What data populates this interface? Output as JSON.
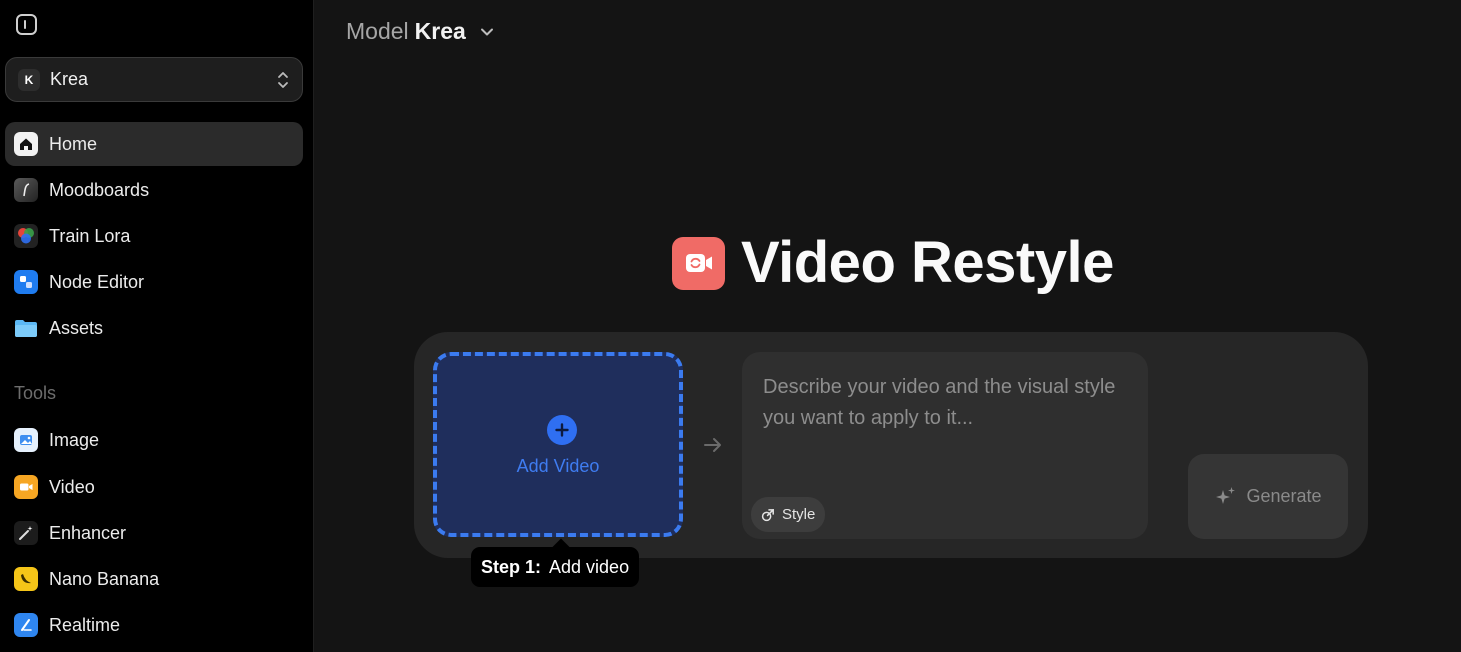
{
  "sidebar": {
    "workspace": {
      "logo": "K",
      "name": "Krea"
    },
    "nav": [
      {
        "label": "Home",
        "icon": "home-icon",
        "active": true
      },
      {
        "label": "Moodboards",
        "icon": "moodboard-icon"
      },
      {
        "label": "Train Lora",
        "icon": "train-lora-icon"
      },
      {
        "label": "Node Editor",
        "icon": "node-editor-icon"
      },
      {
        "label": "Assets",
        "icon": "folder-icon"
      }
    ],
    "tools_label": "Tools",
    "tools": [
      {
        "label": "Image",
        "icon": "image-icon"
      },
      {
        "label": "Video",
        "icon": "video-icon"
      },
      {
        "label": "Enhancer",
        "icon": "enhancer-icon"
      },
      {
        "label": "Nano Banana",
        "icon": "banana-icon"
      },
      {
        "label": "Realtime",
        "icon": "realtime-icon"
      }
    ]
  },
  "header": {
    "model_prefix": "Model",
    "model_name": "Krea"
  },
  "hero": {
    "title": "Video Restyle",
    "icon": "video-restyle-icon"
  },
  "dropzone": {
    "label": "Add Video"
  },
  "prompt": {
    "placeholder": "Describe your video and the visual style you want to apply to it...",
    "style_label": "Style"
  },
  "generate": {
    "label": "Generate"
  },
  "tooltip": {
    "step": "Step 1:",
    "text": "Add video"
  },
  "colors": {
    "accent": "#3b7bf0",
    "hero_icon": "#f06b66",
    "dropzone_bg": "#1f2e5c"
  }
}
